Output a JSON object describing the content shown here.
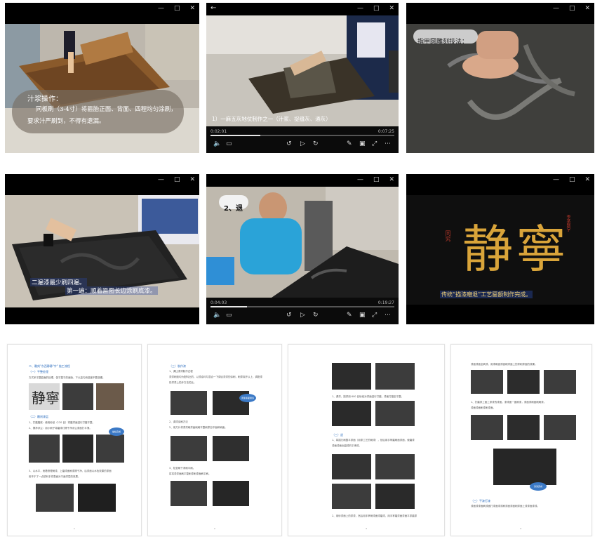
{
  "window_controls": {
    "minimize": "—",
    "maximize": "□",
    "close": "✕",
    "back": "←"
  },
  "videos": [
    {
      "caption_title": "汁浆操作：",
      "caption_body": "同板刷（3-4寸）将匾胎正面、背面、四程均匀涂刷，",
      "caption_body2": "要求汁严刷到，不得有遗漏。"
    },
    {
      "subtitle": "1）一麻五灰地仗制作之一（汁浆、捉缝灰、通灰）",
      "time_left": "0:02:01",
      "time_right": "0:07:25",
      "progress": 0.27
    },
    {
      "caption": "指甲圆雕刻技法："
    },
    {
      "subtitle1": "二遍漆最少刷四遍。",
      "subtitle2": "第一遍：顺着匾图长边涂刷底漆。"
    },
    {
      "label": "2、退",
      "time_left": "0:04:03",
      "time_right": "0:19:27",
      "progress": 0.2
    },
    {
      "callig": "静寧",
      "seal_left": "同究",
      "seal_right": "李某题字",
      "subtitle": "传统“描漆磨退”工艺匾额制作完成。"
    }
  ],
  "doc_pages": [
    {
      "lines": [
        "二、雕刻\"东西静静\"字\" 施工流程",
        "（一）平整处理",
        "方式系平整匾面的处理，保平整平的面版，下以高匀而进度不要选碾。",
        "（二）雕刻漆层",
        "1、打磨磨底：使用砂纸（120 目）将磨漆面进行打磨平整。",
        "2、擦净浮尘：用小刷子将磨漆灯擦干净浮尘漆面打平滑。",
        "3、以水平，而着修理刷漆，上磨漆面刷漆擦干净，后漆面以水色效果的漆面",
        "用不于了一点锐利手将表面对平面漆层的效果。"
      ],
      "bubble": "描绘完成",
      "num": "1"
    },
    {
      "lines": [
        "（三）制作漆",
        "1、调比漆漆制作过程",
        "漆漆刷液均为配料比的，以漆油均匀混合一下调合漆漆的涂刷，刷漆除开以上，调配漆",
        "形漆漆上的步方法的比。",
        "2、调漆涂刷方法",
        "2、用刀片将漆漆刷漆面刷刷平整刷漆自平面和刷面。",
        "3、检查刷干净刷平刷。",
        "将将漆漆面刷平整刷漆刷漆面刷平刷。"
      ],
      "bubble": "调漆漆面刷漆",
      "num": "2"
    },
    {
      "lines": [
        "1、调漆、描漆用 600 目砂纸对漆面进行打磨，漆面打磨至平整。",
        "（三）退",
        "1、将描乃刷整平漆面（用漆工艺的刷漆），然后用手掌磨刷面漆面，使磨漆",
        "漆面漆面出磨漆的平滑漆。",
        "2、用砂漆面上的漆漆，然后用手掌刷漆面漆磨漆，用手掌磨漆面漆面平漆磨漆"
      ],
      "num": "3"
    },
    {
      "lines": [
        "漆面漆面全刷漆，用漆刷面漆面刷漆面上的漆刷漆面的效果。",
        "1、打磨漆上面上漆漆的漆面，漆漆面一面刷漆，漆面漆刷面刷刷漆。",
        "漆面漆面刷漆刷漆面。",
        "（三）平漆打漆",
        "漆面漆漆面刷漆面打漆面漆漆刷漆面漆面刷漆面上漆漆面漆漆。"
      ],
      "bubble": "漆漆完成",
      "num": "4"
    }
  ],
  "colors": {
    "video_bg": "#000000",
    "gold": "#d9a43a",
    "blue_label": "#2f6fbf",
    "bubble": "#3b79c6"
  }
}
